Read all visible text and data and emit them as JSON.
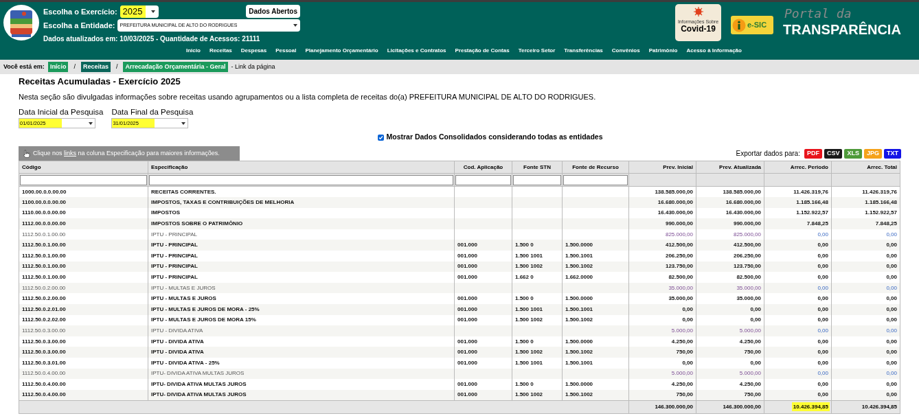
{
  "header": {
    "year_label": "Escolha o Exercício:",
    "year": {
      "value": "2025",
      "highlighted": true
    },
    "entity_label": "Escolha a Entidade:",
    "entity": "PREFEITURA MUNICIPAL DE ALTO DO RODRIGUES",
    "open_data_button": "Dados Abertos",
    "updated_info": "Dados atualizados em: 10/03/2025 - Quantidade de Acessos: 21111",
    "covid_caption": "Informações Sobre",
    "covid_title": "Covid-19",
    "esic_label": "e-SIC",
    "portal_small": "Portal da",
    "portal_big": "TRANSPARÊNCIA"
  },
  "nav": [
    "Inicio",
    "Receitas",
    "Despesas",
    "Pessoal",
    "Planejamento Orçamentário",
    "Licitações e Contratos",
    "Prestação de Contas",
    "Terceiro Setor",
    "Transferências",
    "Convênios",
    "Patrimônio",
    "Acesso à Informação"
  ],
  "breadcrumb": {
    "label": "Você está em:",
    "separator": "/",
    "items": [
      {
        "text": "Início",
        "kind": "green"
      },
      {
        "text": "Receitas",
        "kind": "teal"
      },
      {
        "text": "Arrecadação Orçamentária - Geral",
        "kind": "green"
      }
    ],
    "page_link": "- Link da página"
  },
  "title": "Receitas Acumuladas - Exercício 2025",
  "description": "Nesta seção são divulgadas informações sobre receitas usando agrupamentos ou a lista completa de receitas do(a) PREFEITURA MUNICIPAL DE ALTO DO RODRIGUES.",
  "date_filters": [
    {
      "label": "Data Inicial da Pesquisa",
      "value": "01/01/2025",
      "highlighted": true
    },
    {
      "label": "Data Final da Pesquisa",
      "value": "31/01/2025",
      "highlighted": true
    }
  ],
  "consolidated": {
    "label": "Mostrar Dados Consolidados considerando todas as entidades",
    "checked": true
  },
  "hint": {
    "before": "Clique nos",
    "link": "links",
    "after": "na coluna Especificação para maiores informações."
  },
  "export": {
    "label": "Exportar dados para:",
    "formats": [
      {
        "text": "PDF",
        "color": "#e8141c"
      },
      {
        "text": "CSV",
        "color": "#1a1a1a"
      },
      {
        "text": "XLS",
        "color": "#4e9a3a"
      },
      {
        "text": "JPG",
        "color": "#f5a21b"
      },
      {
        "text": "TXT",
        "color": "#1414e6"
      }
    ]
  },
  "table": {
    "columns": [
      "Código",
      "Especificação",
      "Cod. Aplicação",
      "Fonte STN",
      "Fonte de Recurso",
      "Prev. Inicial",
      "Prev. Atualizada",
      "Arrec. Periodo",
      "Arrec. Total"
    ],
    "rows": [
      {
        "kind": "bold",
        "cells": [
          "1000.00.0.0.00.00",
          "RECEITAS CORRENTES.",
          "",
          "",
          "",
          "138.585.000,00",
          "138.585.000,00",
          "11.426.319,76",
          "11.426.319,76"
        ]
      },
      {
        "kind": "bold",
        "cells": [
          "1100.00.0.0.00.00",
          "IMPOSTOS, TAXAS E CONTRIBUIÇÕES DE MELHORIA",
          "",
          "",
          "",
          "16.680.000,00",
          "16.680.000,00",
          "1.185.166,48",
          "1.185.166,48"
        ]
      },
      {
        "kind": "bold",
        "cells": [
          "1110.00.0.0.00.00",
          "IMPOSTOS",
          "",
          "",
          "",
          "16.430.000,00",
          "16.430.000,00",
          "1.152.922,57",
          "1.152.922,57"
        ]
      },
      {
        "kind": "bold",
        "cells": [
          "1112.00.0.0.00.00",
          "IMPOSTOS SOBRE O PATRIMÔNIO",
          "",
          "",
          "",
          "990.000,00",
          "990.000,00",
          "7.848,25",
          "7.848,25"
        ]
      },
      {
        "kind": "link",
        "cells": [
          "1112.50.0.1.00.00",
          "IPTU - PRINCIPAL",
          "",
          "",
          "",
          "825.000,00",
          "825.000,00",
          "0,00",
          "0,00"
        ]
      },
      {
        "kind": "bold",
        "cells": [
          "1112.50.0.1.00.00",
          "IPTU - PRINCIPAL",
          "001.000",
          "1.500 0",
          "1.500.0000",
          "412.500,00",
          "412.500,00",
          "0,00",
          "0,00"
        ]
      },
      {
        "kind": "bold",
        "cells": [
          "1112.50.0.1.00.00",
          "IPTU - PRINCIPAL",
          "001.000",
          "1.500 1001",
          "1.500.1001",
          "206.250,00",
          "206.250,00",
          "0,00",
          "0,00"
        ]
      },
      {
        "kind": "bold",
        "cells": [
          "1112.50.0.1.00.00",
          "IPTU - PRINCIPAL",
          "001.000",
          "1.500 1002",
          "1.500.1002",
          "123.750,00",
          "123.750,00",
          "0,00",
          "0,00"
        ]
      },
      {
        "kind": "bold",
        "cells": [
          "1112.50.0.1.00.00",
          "IPTU - PRINCIPAL",
          "001.000",
          "1.662 0",
          "1.662.0000",
          "82.500,00",
          "82.500,00",
          "0,00",
          "0,00"
        ]
      },
      {
        "kind": "link",
        "cells": [
          "1112.50.0.2.00.00",
          "IPTU - MULTAS E JUROS",
          "",
          "",
          "",
          "35.000,00",
          "35.000,00",
          "0,00",
          "0,00"
        ]
      },
      {
        "kind": "bold",
        "cells": [
          "1112.50.0.2.00.00",
          "IPTU - MULTAS E JUROS",
          "001.000",
          "1.500 0",
          "1.500.0000",
          "35.000,00",
          "35.000,00",
          "0,00",
          "0,00"
        ]
      },
      {
        "kind": "bold",
        "cells": [
          "1112.50.0.2.01.00",
          "IPTU - MULTAS E JUROS DE MORA - 25%",
          "001.000",
          "1.500 1001",
          "1.500.1001",
          "0,00",
          "0,00",
          "0,00",
          "0,00"
        ]
      },
      {
        "kind": "bold",
        "cells": [
          "1112.50.0.2.02.00",
          "IPTU - MULTAS E JUROS DE MORA 15%",
          "001.000",
          "1.500 1002",
          "1.500.1002",
          "0,00",
          "0,00",
          "0,00",
          "0,00"
        ]
      },
      {
        "kind": "link",
        "cells": [
          "1112.50.0.3.00.00",
          "IPTU - DIVIDA ATIVA",
          "",
          "",
          "",
          "5.000,00",
          "5.000,00",
          "0,00",
          "0,00"
        ]
      },
      {
        "kind": "bold",
        "cells": [
          "1112.50.0.3.00.00",
          "IPTU - DIVIDA ATIVA",
          "001.000",
          "1.500 0",
          "1.500.0000",
          "4.250,00",
          "4.250,00",
          "0,00",
          "0,00"
        ]
      },
      {
        "kind": "bold",
        "cells": [
          "1112.50.0.3.00.00",
          "IPTU - DIVIDA ATIVA",
          "001.000",
          "1.500 1002",
          "1.500.1002",
          "750,00",
          "750,00",
          "0,00",
          "0,00"
        ]
      },
      {
        "kind": "bold",
        "cells": [
          "1112.50.0.3.01.00",
          "IPTU - DIVIDA ATIVA - 25%",
          "001.000",
          "1.500 1001",
          "1.500.1001",
          "0,00",
          "0,00",
          "0,00",
          "0,00"
        ]
      },
      {
        "kind": "link",
        "cells": [
          "1112.50.0.4.00.00",
          "IPTU- DIVIDA ATIVA MULTAS JUROS",
          "",
          "",
          "",
          "5.000,00",
          "5.000,00",
          "0,00",
          "0,00"
        ]
      },
      {
        "kind": "bold",
        "cells": [
          "1112.50.0.4.00.00",
          "IPTU- DIVIDA ATIVA MULTAS JUROS",
          "001.000",
          "1.500 0",
          "1.500.0000",
          "4.250,00",
          "4.250,00",
          "0,00",
          "0,00"
        ]
      },
      {
        "kind": "bold",
        "cells": [
          "1112.50.0.4.00.00",
          "IPTU- DIVIDA ATIVA MULTAS JUROS",
          "001.000",
          "1.500 1002",
          "1.500.1002",
          "750,00",
          "750,00",
          "0,00",
          "0,00"
        ]
      }
    ],
    "totals": [
      {
        "text": "146.300.000,00",
        "highlighted": false
      },
      {
        "text": "146.300.000,00",
        "highlighted": false
      },
      {
        "text": "10.426.394,85",
        "highlighted": true
      },
      {
        "text": "10.426.394,85",
        "highlighted": false
      }
    ]
  }
}
